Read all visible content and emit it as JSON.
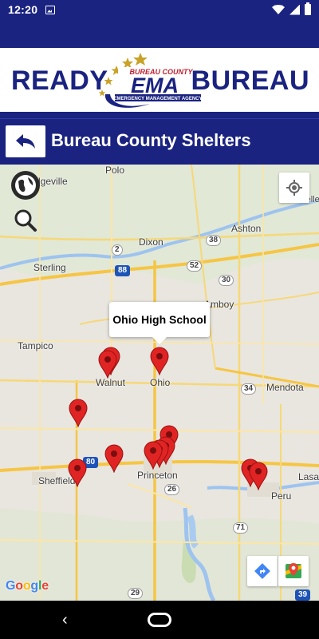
{
  "status_bar": {
    "time": "12:20",
    "icons": [
      "notification-image-icon",
      "wifi-icon",
      "signal-icon",
      "battery-icon"
    ]
  },
  "header": {
    "left_word": "READY",
    "right_word": "BUREAU",
    "logo": {
      "top_text": "BUREAU COUNTY",
      "main_text": "EMA",
      "sub_text": "EMERGENCY MANAGEMENT AGENCY"
    }
  },
  "title_bar": {
    "back_icon": "back-arrow-icon",
    "title": "Bureau County Shelters"
  },
  "map": {
    "places": [
      "Polo",
      "Ashton",
      "Dixon",
      "Sterling",
      "Amboy",
      "Tampico",
      "Walnut",
      "Ohio",
      "Mendota",
      "Sheffield",
      "Princeton",
      "Peru",
      "Lasa",
      "Rochelle",
      "dgeville"
    ],
    "highways": [
      "38",
      "2",
      "88",
      "52",
      "30",
      "34",
      "80",
      "26",
      "71",
      "29",
      "39"
    ],
    "info_window": "Ohio High School",
    "attribution": "Google",
    "controls": [
      "layers-icon",
      "zoom-search-icon",
      "my-location-icon",
      "directions-icon",
      "google-maps-icon"
    ]
  },
  "colors": {
    "brand_navy": "#1a2380",
    "pin_red": "#e02424",
    "gold_star": "#c9a227"
  }
}
